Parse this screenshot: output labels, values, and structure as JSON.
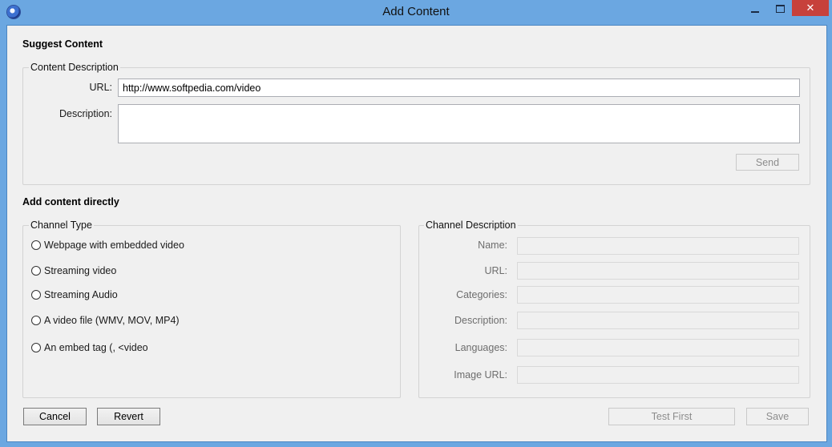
{
  "window": {
    "title": "Add Content",
    "close_glyph": "✕"
  },
  "suggest": {
    "heading": "Suggest Content",
    "group_label": "Content Description",
    "url_label": "URL:",
    "url_value": "http://www.softpedia.com/video",
    "description_label": "Description:",
    "description_value": "",
    "send_label": "Send"
  },
  "direct": {
    "heading": "Add content directly",
    "channel_type": {
      "group_label": "Channel Type",
      "options": [
        "Webpage with embedded video",
        "Streaming video",
        "Streaming Audio",
        "A video file (WMV, MOV, MP4)",
        "An embed tag (, <video"
      ]
    },
    "channel_description": {
      "group_label": "Channel Description",
      "fields": [
        {
          "label": "Name:",
          "value": ""
        },
        {
          "label": "URL:",
          "value": ""
        },
        {
          "label": "Categories:",
          "value": ""
        },
        {
          "label": "Description:",
          "value": ""
        },
        {
          "label": "Languages:",
          "value": ""
        },
        {
          "label": "Image URL:",
          "value": ""
        }
      ]
    }
  },
  "footer": {
    "cancel_label": "Cancel",
    "revert_label": "Revert",
    "test_first_label": "Test First",
    "save_label": "Save"
  }
}
